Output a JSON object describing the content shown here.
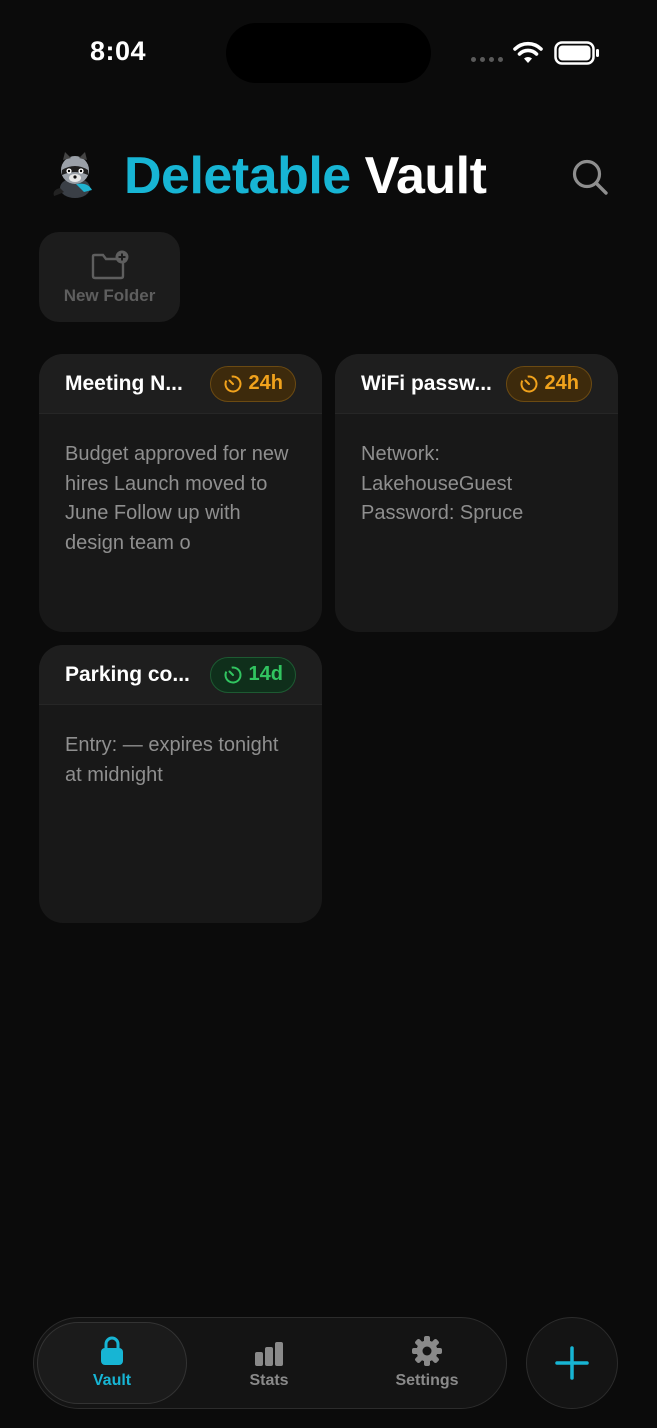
{
  "status_bar": {
    "time": "8:04"
  },
  "header": {
    "title_accent": "Deletable",
    "title_rest": "Vault"
  },
  "folder_button": {
    "label": "New Folder"
  },
  "notes": [
    {
      "title": "Meeting N...",
      "timer": "24h",
      "timer_color": "#f0a21c",
      "preview": "Budget approved for new hires Launch moved to June  Follow up with design team o"
    },
    {
      "title": "WiFi passw...",
      "timer": "24h",
      "timer_color": "#f0a21c",
      "preview": "Network: LakehouseGuest Password: Spruce"
    },
    {
      "title": "Parking co...",
      "timer": "14d",
      "timer_color": "#31c460",
      "preview": "Entry:  — expires tonight at midnight"
    }
  ],
  "tabbar": {
    "tabs": [
      {
        "label": "Vault",
        "icon": "lock-icon",
        "active": true,
        "color": "#17b5d4"
      },
      {
        "label": "Stats",
        "icon": "bar-chart-icon",
        "active": false,
        "color": "#8a8a8a"
      },
      {
        "label": "Settings",
        "icon": "gear-icon",
        "active": false,
        "color": "#8a8a8a"
      }
    ]
  },
  "fab": {
    "icon": "plus-icon",
    "color": "#17b5d4"
  },
  "colors": {
    "accent": "#17b5d4",
    "background": "#0b0b0b",
    "card": "#181818"
  }
}
